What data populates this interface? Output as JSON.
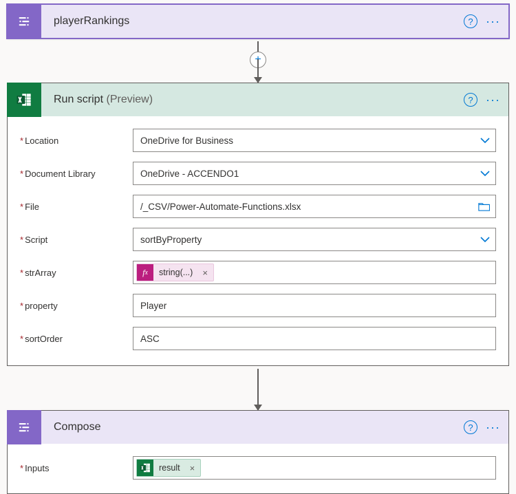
{
  "step1": {
    "title": "playerRankings"
  },
  "step2": {
    "title": "Run script",
    "preview": "(Preview)",
    "fields": {
      "location": {
        "label": "Location",
        "value": "OneDrive for Business"
      },
      "docLibrary": {
        "label": "Document Library",
        "value": "OneDrive - ACCENDO1"
      },
      "file": {
        "label": "File",
        "value": "/_CSV/Power-Automate-Functions.xlsx"
      },
      "script": {
        "label": "Script",
        "value": "sortByProperty"
      },
      "strArray": {
        "label": "strArray",
        "chip": "string(...)"
      },
      "property": {
        "label": "property",
        "value": "Player"
      },
      "sortOrder": {
        "label": "sortOrder",
        "value": "ASC"
      }
    }
  },
  "step3": {
    "title": "Compose",
    "inputs": {
      "label": "Inputs",
      "chip": "result"
    }
  }
}
